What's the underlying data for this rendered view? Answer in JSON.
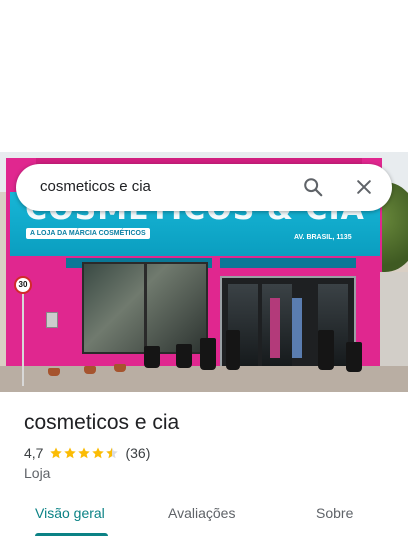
{
  "search": {
    "query": "cosmeticos e cia"
  },
  "photo": {
    "sign_text": "COSMETICOS & CIA",
    "sign_subtitle": "A LOJA DA MÁRCIA COSMÉTICOS",
    "sign_address": "AV. BRASIL, 1135",
    "speed_limit": "30"
  },
  "place": {
    "name": "cosmeticos e cia",
    "rating": "4,7",
    "rating_value": 4.7,
    "review_count": "(36)",
    "category": "Loja"
  },
  "tabs": [
    {
      "label": "Visão geral",
      "active": true
    },
    {
      "label": "Avaliações",
      "active": false
    },
    {
      "label": "Sobre",
      "active": false
    }
  ],
  "colors": {
    "accent": "#0b8285",
    "star": "#fbbc04",
    "facade": "#e0278f",
    "sign": "#18b6d6"
  }
}
